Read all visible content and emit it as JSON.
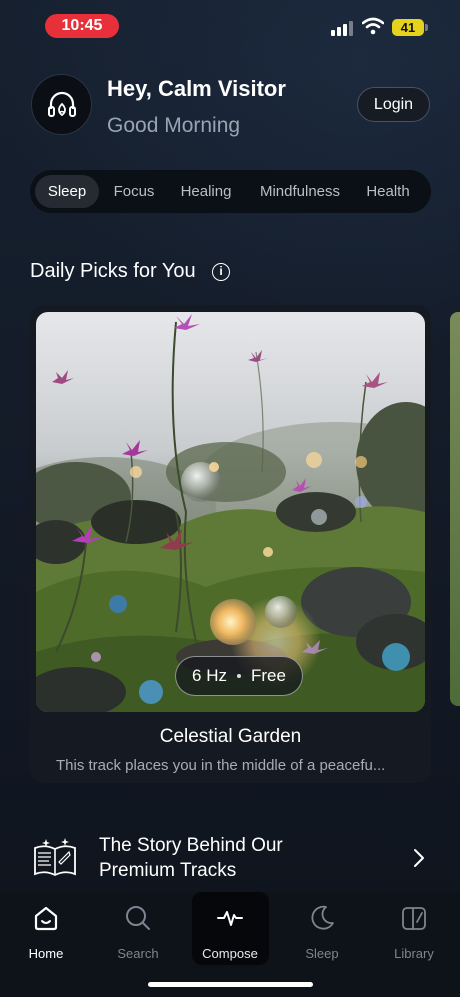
{
  "status_bar": {
    "time": "10:45",
    "battery_level": "41",
    "icons": [
      "signal-icon",
      "wifi-icon",
      "battery-icon"
    ]
  },
  "header": {
    "title": "Hey, Calm Visitor",
    "subtitle": "Good Morning",
    "login_label": "Login",
    "avatar_icon": "headphones-logo-icon"
  },
  "tabs": [
    {
      "label": "Sleep",
      "active": true
    },
    {
      "label": "Focus",
      "active": false
    },
    {
      "label": "Healing",
      "active": false
    },
    {
      "label": "Mindfulness",
      "active": false
    },
    {
      "label": "Health",
      "active": false
    }
  ],
  "daily_picks": {
    "section_title": "Daily Picks for You",
    "info_icon": "info-icon",
    "card": {
      "frequency": "6 Hz",
      "price": "Free",
      "title": "Celestial Garden",
      "description": "This track places you in the middle of a peacefu..."
    }
  },
  "story": {
    "line1": "The Story Behind Our",
    "line2": "Premium Tracks",
    "icon": "open-book-icon",
    "chevron": "chevron-right-icon"
  },
  "bottom_nav": {
    "items": [
      {
        "label": "Home",
        "icon": "home-icon",
        "active": true
      },
      {
        "label": "Search",
        "icon": "search-icon",
        "active": false
      },
      {
        "label": "Compose",
        "icon": "waveform-icon",
        "active": false
      },
      {
        "label": "Sleep",
        "icon": "moon-icon",
        "active": false
      },
      {
        "label": "Library",
        "icon": "library-icon",
        "active": false
      }
    ]
  },
  "colors": {
    "background": "#121b2a",
    "time_pill": "#e8303a",
    "battery": "#e6d21c",
    "muted_text": "#9aa3b0"
  }
}
